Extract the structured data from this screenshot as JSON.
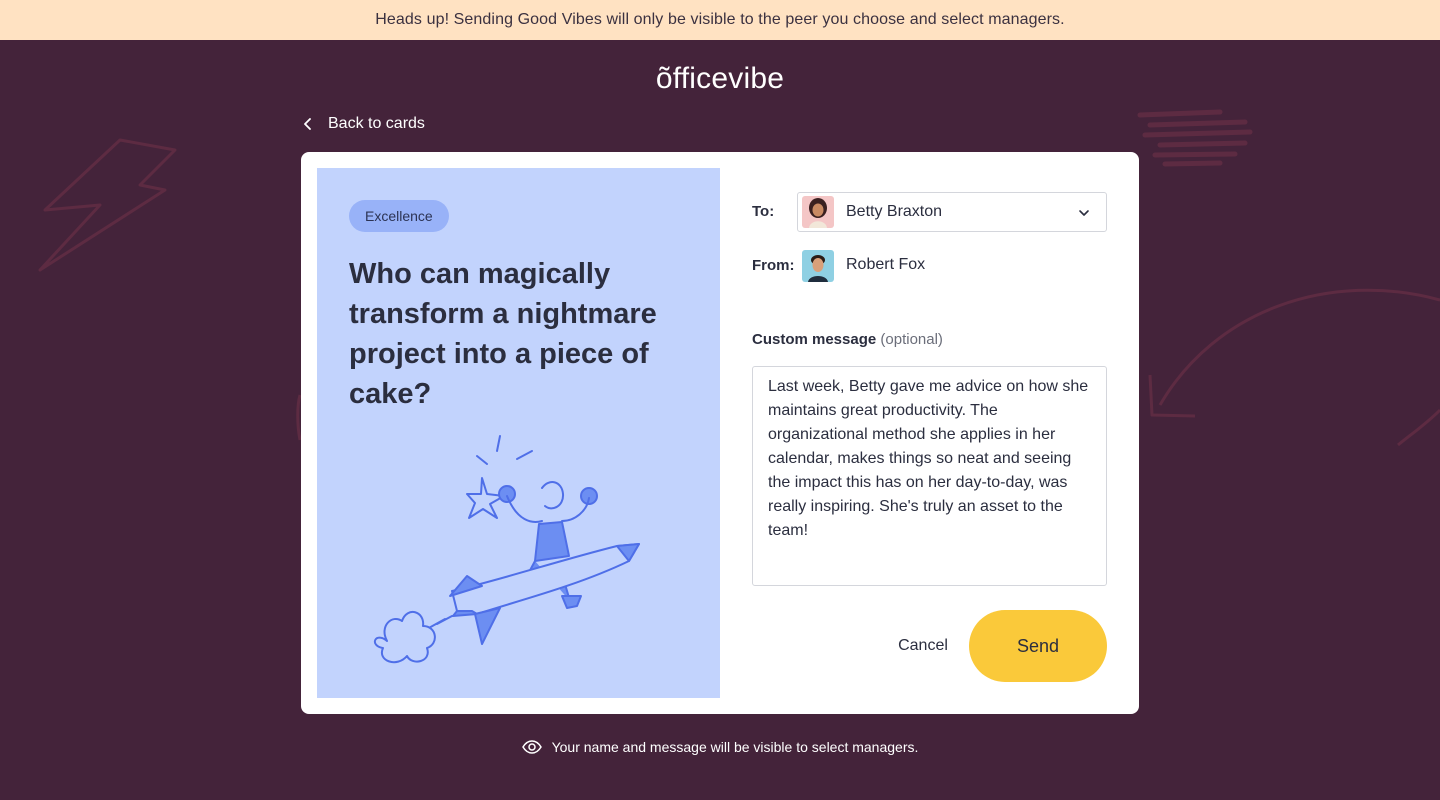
{
  "banner": {
    "text": "Heads up! Sending Good Vibes will only be visible to the peer you choose and select managers."
  },
  "brand": {
    "logo_text": "õfficevibe"
  },
  "nav": {
    "back_label": "Back to cards",
    "back_icon": "chevron-left-icon"
  },
  "card": {
    "tag": "Excellence",
    "question": "Who can magically transform a nightmare project into a piece of cake?",
    "illustration": "person-riding-rocket-pen-illustration",
    "background_color": "#c2d3fd",
    "tag_color": "#98b2f8"
  },
  "form": {
    "to_label": "To:",
    "recipient": {
      "name": "Betty Braxton",
      "icon": "chevron-down-icon"
    },
    "from_label": "From:",
    "sender": {
      "name": "Robert Fox"
    },
    "message_label": "Custom message",
    "message_optional": "(optional)",
    "message": "Last week, Betty gave me advice on how she maintains great productivity. The organizational method she applies in her calendar, makes things so neat and seeing the impact this has on her day-to-day, was really inspiring. She's truly an asset to the team!",
    "cancel_label": "Cancel",
    "send_label": "Send"
  },
  "footer": {
    "notice": "Your name and message will be visible to select managers.",
    "icon": "eye-icon"
  },
  "colors": {
    "page_bg": "#44233a",
    "banner_bg": "#ffe2c2",
    "send_button": "#fac93a"
  }
}
